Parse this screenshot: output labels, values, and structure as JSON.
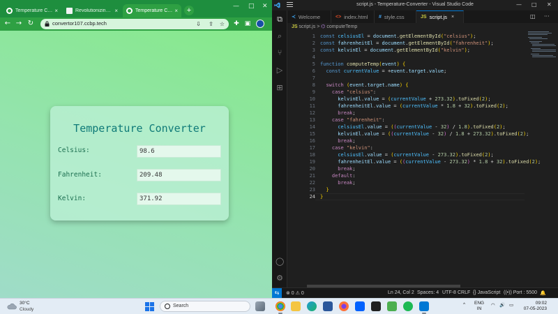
{
  "browser": {
    "tabs": [
      {
        "label": "Temperature Conve",
        "active": false
      },
      {
        "label": "Revolutionizing th",
        "active": false
      },
      {
        "label": "Temperature Conve",
        "active": true
      }
    ],
    "url": "convertor107.ccbp.tech",
    "accent": "#2ea043"
  },
  "app": {
    "title": "Temperature Converter",
    "fields": [
      {
        "label": "Celsius:",
        "value": "98.6"
      },
      {
        "label": "Fahrenheit:",
        "value": "209.48"
      },
      {
        "label": "Kelvin:",
        "value": "371.92"
      }
    ]
  },
  "vscode": {
    "title": "script.js - Temperature-Converter - Visual Studio Code",
    "tabs": [
      {
        "label": "Welcome",
        "icon": "vscode-icon"
      },
      {
        "label": "index.html",
        "icon": "html-icon"
      },
      {
        "label": "style.css",
        "icon": "css-icon"
      },
      {
        "label": "script.js",
        "icon": "js-icon",
        "active": true
      }
    ],
    "breadcrumb": {
      "file": "script.js",
      "separator": ">",
      "symbol": "computeTemp"
    },
    "code_lines": [
      "const celsiusEl = document.getElementById(\"celsius\");",
      "const fahrenheitEl = document.getElementById(\"fahrenheit\");",
      "const kelvinEl = document.getElementById(\"kelvin\");",
      "",
      "function computeTemp(event) {",
      "  const currentValue = +event.target.value;",
      "",
      "  switch (event.target.name) {",
      "    case \"celsius\":",
      "      kelvinEl.value = (currentValue + 273.32).toFixed(2);",
      "      fahrenheitEl.value = (currentValue * 1.8 + 32).toFixed(2);",
      "      break;",
      "    case \"fahrenheit\":",
      "      celsiusEl.value = ((currentValue - 32) / 1.8).toFixed(2);",
      "      kelvinEl.value = ((currentValue - 32) / 1.8 + 273.32).toFixed(2);",
      "      break;",
      "    case \"kelvin\":",
      "      celsiusEl.value = (currentValue - 273.32).toFixed(2);",
      "      fahrenheitEl.value = ((currentValue - 273.32) * 1.8 + 32).toFixed(2);",
      "      break;",
      "    default:",
      "      break;",
      "  }",
      "}"
    ],
    "current_line": 24,
    "status": {
      "problems": "⊗ 0  ⚠ 0",
      "position": "Ln 24, Col 2",
      "spaces": "Spaces: 4",
      "encoding": "UTF-8",
      "eol": "CRLF",
      "language": "{} JavaScript",
      "port": "Port : 5500"
    },
    "accent": "#0078d4"
  },
  "taskbar": {
    "weather_temp": "30°C",
    "weather_desc": "Cloudy",
    "search_placeholder": "Search",
    "lang": "ENG",
    "lang_region": "IN",
    "time": "09:02",
    "date": "07-05-2023"
  }
}
